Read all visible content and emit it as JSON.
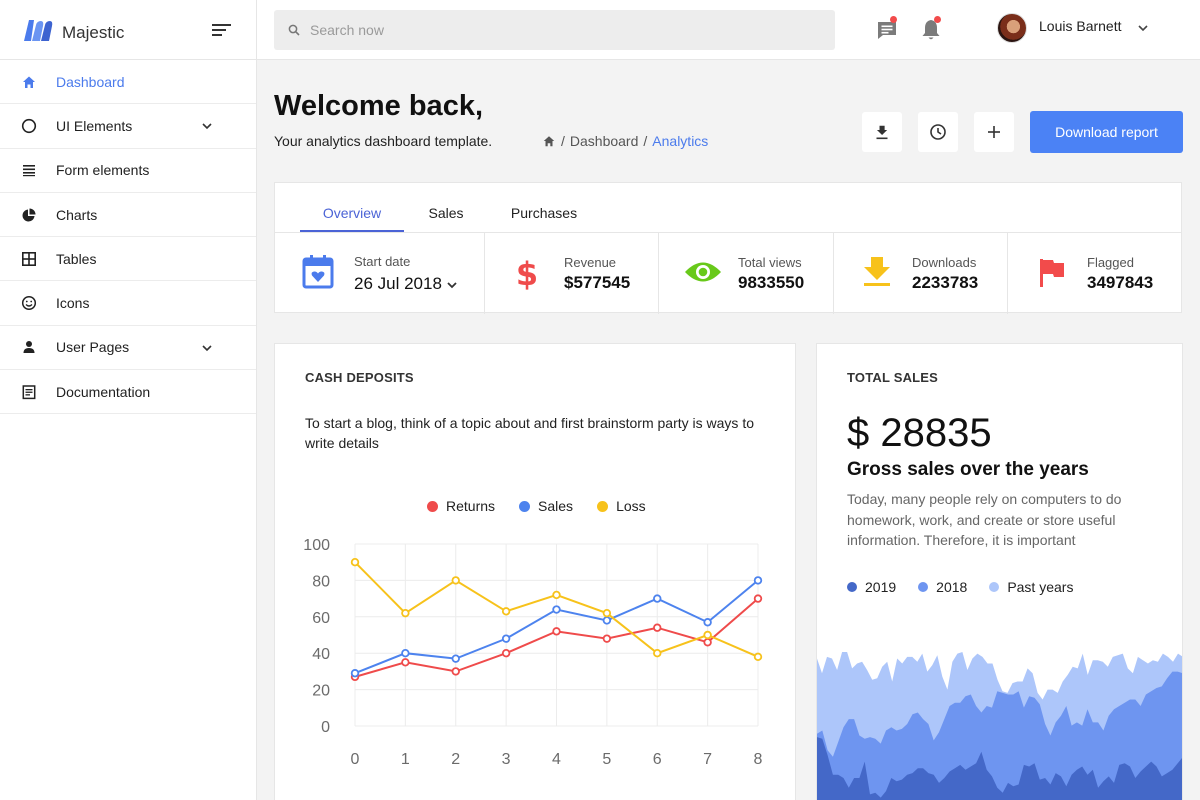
{
  "brand": {
    "name": "Majestic"
  },
  "sidebar": {
    "items": [
      {
        "label": "Dashboard",
        "icon": "home-icon",
        "active": true
      },
      {
        "label": "UI Elements",
        "icon": "circle-icon",
        "expandable": true
      },
      {
        "label": "Form elements",
        "icon": "list-icon"
      },
      {
        "label": "Charts",
        "icon": "pie-chart-icon"
      },
      {
        "label": "Tables",
        "icon": "grid-icon"
      },
      {
        "label": "Icons",
        "icon": "smiley-icon"
      },
      {
        "label": "User Pages",
        "icon": "user-icon",
        "expandable": true
      },
      {
        "label": "Documentation",
        "icon": "document-icon"
      }
    ]
  },
  "topbar": {
    "search_placeholder": "Search now",
    "user_name": "Louis Barnett"
  },
  "header": {
    "title": "Welcome back,",
    "subtitle": "Your analytics dashboard template.",
    "breadcrumb": [
      "Dashboard",
      "Analytics"
    ],
    "download_button": "Download report"
  },
  "tabs": [
    "Overview",
    "Sales",
    "Purchases"
  ],
  "stats": [
    {
      "label": "Start date",
      "value": "26 Jul 2018",
      "icon": "calendar-icon"
    },
    {
      "label": "Revenue",
      "value": "$577545",
      "icon": "dollar-icon"
    },
    {
      "label": "Total views",
      "value": "9833550",
      "icon": "eye-icon"
    },
    {
      "label": "Downloads",
      "value": "2233783",
      "icon": "download-icon"
    },
    {
      "label": "Flagged",
      "value": "3497843",
      "icon": "flag-icon"
    }
  ],
  "cash": {
    "title": "CASH DEPOSITS",
    "description": "To start a blog, think of a topic about and first brainstorm party is ways to write details"
  },
  "total_sales": {
    "title": "TOTAL SALES",
    "amount": "$ 28835",
    "heading": "Gross sales over the years",
    "description": "Today, many people rely on computers to do homework, work, and create or store useful information. Therefore, it is important",
    "legend": [
      {
        "name": "2019",
        "color": "#4468c8"
      },
      {
        "name": "2018",
        "color": "#6e95f0"
      },
      {
        "name": "Past years",
        "color": "#adc6fa"
      }
    ]
  },
  "colors": {
    "accent": "#4b7bec",
    "primary_button": "#4b82f5",
    "returns": "#ef4b4b",
    "sales": "#4d83ee",
    "loss": "#f7c21b"
  },
  "chart_data": [
    {
      "type": "line",
      "x": [
        0,
        1,
        2,
        3,
        4,
        5,
        6,
        7,
        8
      ],
      "series": [
        {
          "name": "Returns",
          "color": "#ef4b4b",
          "values": [
            27,
            35,
            30,
            40,
            52,
            48,
            54,
            46,
            70
          ]
        },
        {
          "name": "Sales",
          "color": "#4d83ee",
          "values": [
            29,
            40,
            37,
            48,
            64,
            58,
            70,
            57,
            80
          ]
        },
        {
          "name": "Loss",
          "color": "#f7c21b",
          "values": [
            90,
            62,
            80,
            63,
            72,
            62,
            40,
            50,
            38
          ]
        }
      ],
      "ylim": [
        0,
        100
      ],
      "yticks": [
        0,
        20,
        40,
        60,
        80,
        100
      ],
      "xticks": [
        0,
        1,
        2,
        3,
        4,
        5,
        6,
        7,
        8
      ],
      "legend": "top-center",
      "grid": true
    },
    {
      "type": "area",
      "series": [
        {
          "name": "Past years",
          "color": "#adc6fa",
          "values": [
            95,
            86,
            96,
            95,
            88,
            99,
            99,
            89,
            92,
            93,
            88,
            82,
            83,
            90,
            93,
            81,
            95,
            92,
            96,
            96,
            93,
            98,
            87,
            91,
            97,
            84,
            76,
            93,
            98,
            99,
            88,
            95,
            98,
            96,
            92,
            92,
            82,
            75,
            74,
            80,
            81,
            81,
            89,
            86,
            74,
            70,
            76,
            76,
            74,
            81,
            85,
            90,
            89,
            98,
            85,
            94,
            94,
            93,
            90,
            96,
            97,
            98,
            89,
            86,
            96,
            94,
            92,
            94,
            93,
            98,
            96,
            93,
            98,
            96
          ]
        },
        {
          "name": "2018",
          "color": "#6e95f0",
          "values": [
            49,
            51,
            39,
            35,
            44,
            53,
            58,
            58,
            48,
            46,
            47,
            46,
            43,
            51,
            53,
            51,
            52,
            55,
            61,
            62,
            58,
            55,
            45,
            50,
            58,
            66,
            68,
            68,
            72,
            73,
            66,
            62,
            66,
            65,
            75,
            74,
            73,
            73,
            75,
            65,
            72,
            71,
            67,
            55,
            48,
            56,
            60,
            66,
            54,
            56,
            54,
            64,
            56,
            56,
            51,
            60,
            64,
            66,
            68,
            70,
            70,
            66,
            73,
            75,
            77,
            78,
            83,
            87,
            87,
            86
          ]
        },
        {
          "name": "2019",
          "color": "#4468c8",
          "values": [
            47,
            46,
            36,
            24,
            24,
            22,
            16,
            22,
            22,
            32,
            12,
            13,
            10,
            14,
            22,
            20,
            21,
            24,
            25,
            28,
            28,
            25,
            24,
            19,
            22,
            26,
            28,
            30,
            27,
            29,
            31,
            38,
            27,
            23,
            16,
            13,
            19,
            17,
            18,
            30,
            29,
            31,
            21,
            22,
            18,
            25,
            23,
            17,
            24,
            27,
            29,
            24,
            27,
            16,
            20,
            23,
            19,
            30,
            31,
            29,
            22,
            26,
            29,
            32,
            29,
            23,
            25,
            27,
            31,
            35
          ]
        }
      ],
      "legend": "top-left"
    }
  ]
}
